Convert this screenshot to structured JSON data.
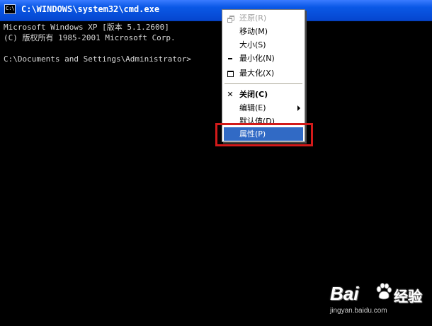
{
  "window": {
    "title": "C:\\WINDOWS\\system32\\cmd.exe",
    "icon_name": "cmd-window-icon",
    "icon_text": "C:\\"
  },
  "console": {
    "lines": [
      "Microsoft Windows XP [版本 5.1.2600]",
      "(C) 版权所有 1985-2001 Microsoft Corp.",
      "",
      "C:\\Documents and Settings\\Administrator>"
    ]
  },
  "system_menu": {
    "items": [
      {
        "label": "还原(R)",
        "icon": "restore-icon",
        "enabled": false
      },
      {
        "label": "移动(M)",
        "icon": "",
        "enabled": true
      },
      {
        "label": "大小(S)",
        "icon": "",
        "enabled": true
      },
      {
        "label": "最小化(N)",
        "icon": "minimize-icon",
        "enabled": true
      },
      {
        "label": "最大化(X)",
        "icon": "maximize-icon",
        "enabled": true
      },
      {
        "label": "关闭(C)",
        "icon": "close-icon",
        "enabled": true,
        "bold": true
      },
      {
        "label": "编辑(E)",
        "icon": "",
        "enabled": true,
        "submenu": true
      },
      {
        "label": "默认值(D)",
        "icon": "",
        "enabled": true
      },
      {
        "label": "属性(P)",
        "icon": "",
        "enabled": true,
        "highlighted": true
      }
    ],
    "icons": {
      "close_glyph": "✕"
    }
  },
  "annotation": {
    "color": "#d21a1a",
    "target": "属性(P)"
  },
  "watermark": {
    "brand": "Bai",
    "product": "经验",
    "url": "jingyan.baidu.com"
  },
  "colors": {
    "titlebar": "#0546cf",
    "console_bg": "#000000",
    "console_text": "#d8d8d8",
    "menu_highlight": "#316ac5"
  }
}
